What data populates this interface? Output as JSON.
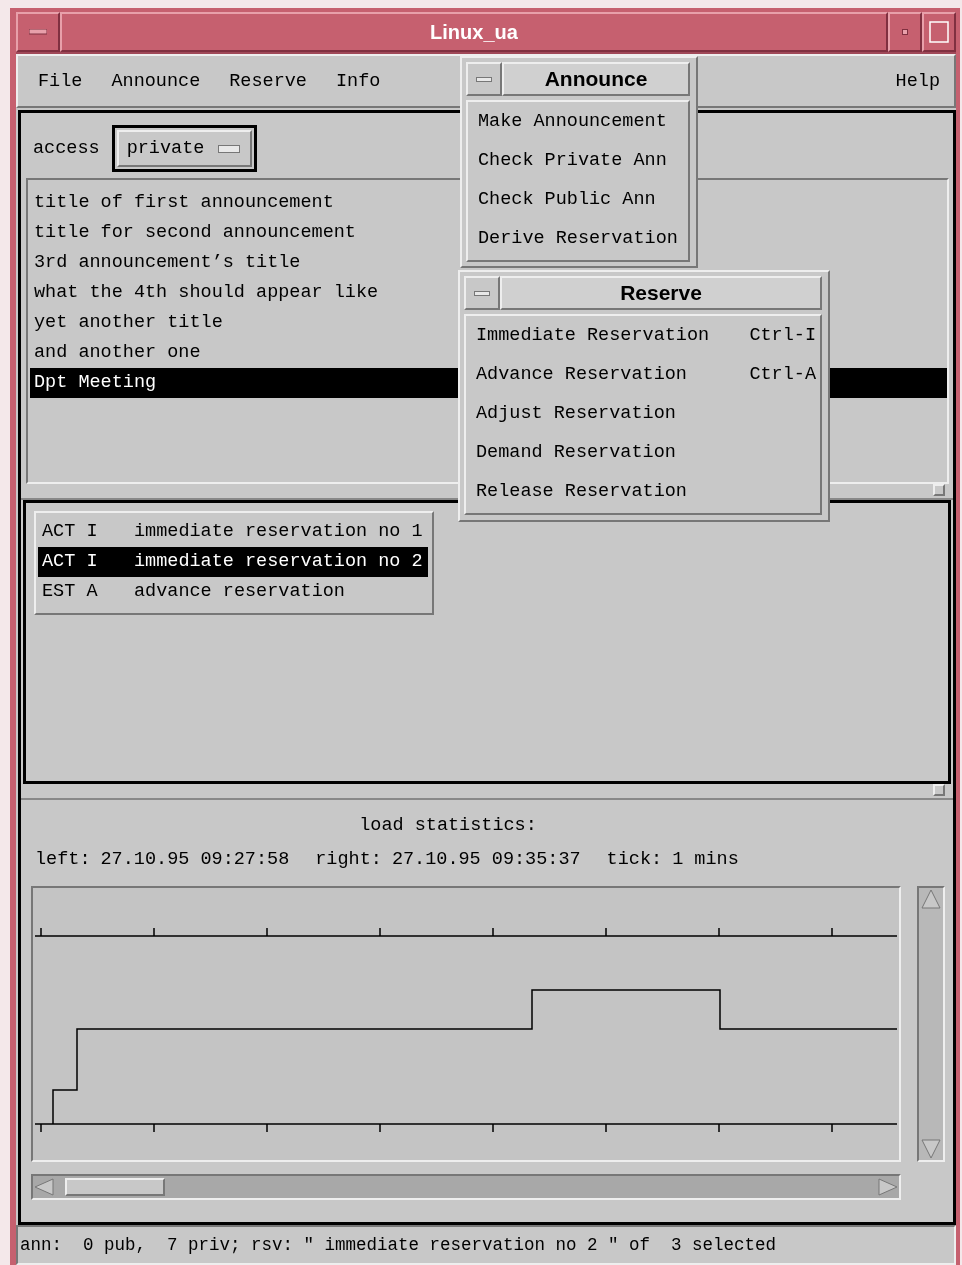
{
  "window": {
    "title": "Linux_ua"
  },
  "menubar": [
    {
      "label": "File"
    },
    {
      "label": "Announce"
    },
    {
      "label": "Reserve"
    },
    {
      "label": "Info"
    },
    {
      "label": "Help"
    }
  ],
  "access": {
    "label": "access",
    "value": "private"
  },
  "announcements": [
    {
      "title": "title of first announcement",
      "selected": false
    },
    {
      "title": "title for second announcement",
      "selected": false
    },
    {
      "title": "3rd announcement’s title",
      "selected": false
    },
    {
      "title": "what the 4th should appear like",
      "selected": false
    },
    {
      "title": "yet another title",
      "selected": false
    },
    {
      "title": "and another one",
      "selected": false
    },
    {
      "title": "Dpt Meeting",
      "selected": true
    }
  ],
  "reservations": [
    {
      "status": "ACT I",
      "description": "immediate reservation no 1",
      "selected": false
    },
    {
      "status": "ACT I",
      "description": "immediate reservation no 2",
      "selected": true
    },
    {
      "status": "EST A",
      "description": "advance reservation",
      "selected": false
    }
  ],
  "statistics": {
    "title": "load statistics:",
    "fields": [
      {
        "label": "left:",
        "value": "27.10.95 09:27:58"
      },
      {
        "label": "right:",
        "value": "27.10.95 09:35:37"
      },
      {
        "label": "tick:",
        "value": "1 mins"
      }
    ]
  },
  "status_bar": "ann:  0 pub,  7 priv; rsv: \" immediate reservation no 2 \" of  3 selected",
  "announce_menu": {
    "title": "Announce",
    "items": [
      {
        "label": "Make Announcement"
      },
      {
        "label": "Check Private Ann"
      },
      {
        "label": "Check Public Ann"
      },
      {
        "label": "Derive Reservation"
      }
    ]
  },
  "reserve_menu": {
    "title": "Reserve",
    "items": [
      {
        "label": "Immediate Reservation",
        "shortcut": "Ctrl-I"
      },
      {
        "label": "Advance Reservation",
        "shortcut": "Ctrl-A"
      },
      {
        "label": "Adjust Reservation"
      },
      {
        "label": "Demand Reservation"
      },
      {
        "label": "Release Reservation"
      }
    ]
  }
}
